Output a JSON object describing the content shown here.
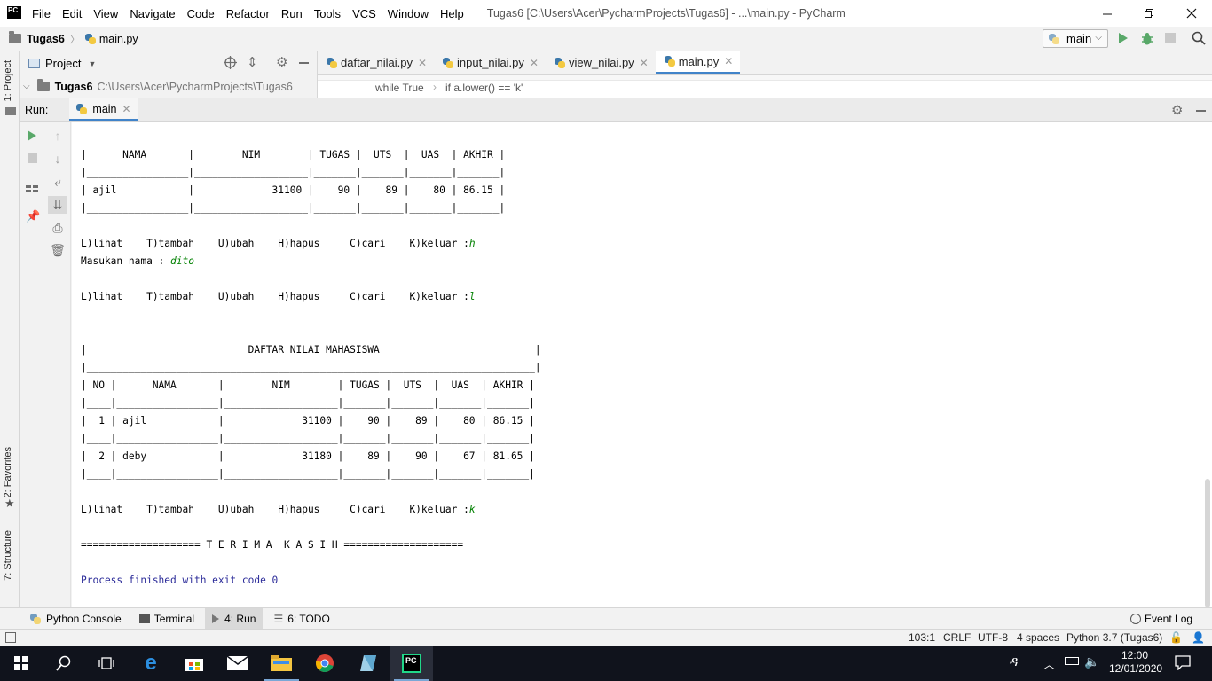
{
  "menubar": {
    "logo": "PC",
    "items": [
      "File",
      "Edit",
      "View",
      "Navigate",
      "Code",
      "Refactor",
      "Run",
      "Tools",
      "VCS",
      "Window",
      "Help"
    ],
    "window_title": "Tugas6 [C:\\Users\\Acer\\PycharmProjects\\Tugas6] - ...\\main.py - PyCharm"
  },
  "navbar": {
    "project": "Tugas6",
    "file": "main.py",
    "run_config": "main"
  },
  "sidebar": {
    "project_tab": "1: Project",
    "favorites_tab": "2: Favorites",
    "structure_tab": "7: Structure"
  },
  "project_panel": {
    "title": "Project",
    "root_name": "Tugas6",
    "root_path": "C:\\Users\\Acer\\PycharmProjects\\Tugas6"
  },
  "editor": {
    "tabs": [
      {
        "label": "daftar_nilai.py"
      },
      {
        "label": "input_nilai.py"
      },
      {
        "label": "view_nilai.py"
      },
      {
        "label": "main.py"
      }
    ],
    "breadcrumb": [
      "while True",
      "if a.lower() == 'k'"
    ]
  },
  "run_panel": {
    "label": "Run:",
    "tab": "main"
  },
  "console": {
    "lines": [
      " ____________________________________________________________________",
      "|      NAMA       |        NIM        | TUGAS |  UTS  |  UAS  | AKHIR |",
      "|_________________|___________________|_______|_______|_______|_______|",
      "| ajil            |             31100 |    90 |    89 |    80 | 86.15 |",
      "|_________________|___________________|_______|_______|_______|_______|",
      "",
      "L)lihat    T)tambah    U)ubah    H)hapus     C)cari    K)keluar :",
      "Masukan nama : ",
      "",
      "L)lihat    T)tambah    U)ubah    H)hapus     C)cari    K)keluar :",
      "",
      " ____________________________________________________________________________",
      "|                           DAFTAR NILAI MAHASISWA                          |",
      "|___________________________________________________________________________|",
      "| NO |      NAMA       |        NIM        | TUGAS |  UTS  |  UAS  | AKHIR |",
      "|____|_________________|___________________|_______|_______|_______|_______|",
      "|  1 | ajil            |             31100 |    90 |    89 |    80 | 86.15 |",
      "|____|_________________|___________________|_______|_______|_______|_______|",
      "|  2 | deby            |             31180 |    89 |    90 |    67 | 81.65 |",
      "|____|_________________|___________________|_______|_______|_______|_______|",
      "",
      "L)lihat    T)tambah    U)ubah    H)hapus     C)cari    K)keluar :",
      "",
      "==================== T E R I M A  K A S I H ===================="
    ],
    "inputs": {
      "h": "h",
      "dito": "dito",
      "l": "l",
      "k": "k"
    },
    "exit_message": "Process finished with exit code 0"
  },
  "bottom_tabs": {
    "python_console": "Python Console",
    "terminal": "Terminal",
    "run": "4: Run",
    "todo": "6: TODO",
    "event_log": "Event Log"
  },
  "status_bar": {
    "position": "103:1",
    "line_sep": "CRLF",
    "encoding": "UTF-8",
    "indent": "4 spaces",
    "interpreter": "Python 3.7 (Tugas6)"
  },
  "taskbar": {
    "time": "12:00",
    "date": "12/01/2020"
  },
  "colors": {
    "accent": "#4083c9",
    "run_green": "#59a869",
    "input_green": "#008000",
    "exit_blue": "#2b2b99"
  }
}
